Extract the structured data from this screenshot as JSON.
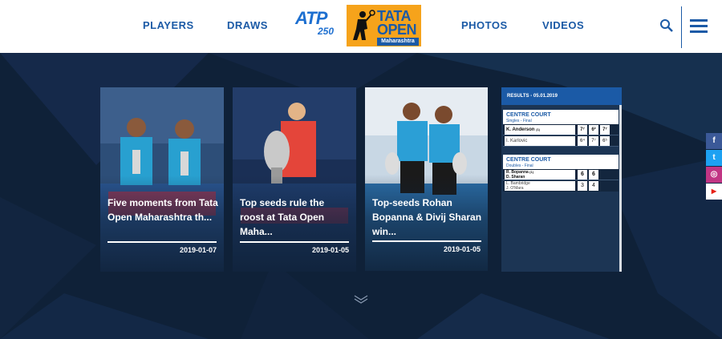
{
  "header": {
    "nav_left": [
      "PLAYERS",
      "DRAWS"
    ],
    "nav_right": [
      "PHOTOS",
      "VIDEOS"
    ],
    "atp_logo": {
      "word": "ATP",
      "number": "250"
    },
    "tournament_logo": {
      "line1": "TATA",
      "line2": "OPEN",
      "line3": "Maharashtra"
    },
    "search_icon": "search-icon",
    "menu_icon": "hamburger-menu-icon"
  },
  "cards": [
    {
      "title": "Five moments from Tata Open Maharashtra th...",
      "date": "2019-01-07"
    },
    {
      "title": "Top seeds rule the roost at Tata Open Maha...",
      "date": "2019-01-05"
    },
    {
      "title": "Top-seeds Rohan Bopanna & Divij Sharan win...",
      "date": "2019-01-05"
    }
  ],
  "results": {
    "heading": "RESULTS - 05.01.2019",
    "matches": [
      {
        "court": "CENTRE COURT",
        "round": "Singles - Final",
        "players": [
          {
            "name": "K. Anderson",
            "seed": "(1)",
            "sets": [
              "7⁷",
              "6²",
              "7⁷"
            ]
          },
          {
            "name": "I. Karlovic",
            "seed": "",
            "sets": [
              "6⁴",
              "7⁷",
              "6⁵"
            ]
          }
        ]
      },
      {
        "court": "CENTRE COURT",
        "round": "Doubles - Final",
        "teams": [
          {
            "line1": "R. Bopanna",
            "line2": "D. Sharan",
            "seed": "(1)",
            "sets": [
              "6",
              "6"
            ]
          },
          {
            "line1": "L. Bambridge",
            "line2": "J. O'Mara",
            "seed": "",
            "sets": [
              "3",
              "4"
            ]
          }
        ]
      }
    ]
  },
  "social": [
    {
      "glyph": "f",
      "icon": "facebook-icon",
      "color": "#3b5998"
    },
    {
      "glyph": "t",
      "icon": "twitter-icon",
      "color": "#1da1f2"
    },
    {
      "glyph": "◎",
      "icon": "instagram-icon",
      "color": "#c13584"
    },
    {
      "glyph": "▶",
      "icon": "youtube-icon",
      "color": "#e62117"
    }
  ],
  "colors": {
    "brand_blue": "#1b5aa6",
    "logo_orange": "#f6a31b",
    "background": "#0f2138"
  }
}
